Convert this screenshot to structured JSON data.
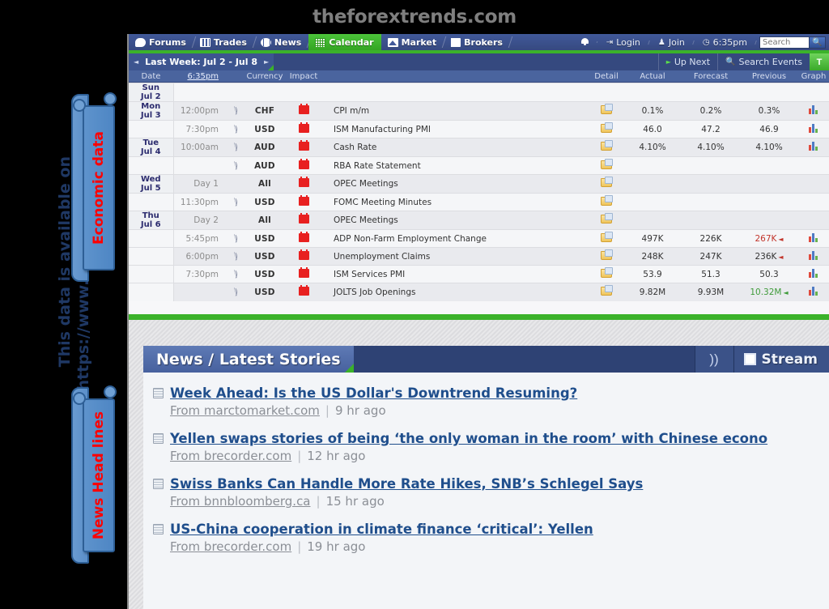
{
  "site_title": "theforextrends.com",
  "annotation": {
    "vertical_note_line1": "This data is available on",
    "vertical_note_line2": "https://www.forexfactory.com",
    "ribbon_economic": "Economic data",
    "ribbon_news": "News Head lines"
  },
  "nav": {
    "items": [
      {
        "label": "Forums",
        "icon": "forums-icon",
        "active": false
      },
      {
        "label": "Trades",
        "icon": "trades-icon",
        "active": false
      },
      {
        "label": "News",
        "icon": "news-icon",
        "active": false
      },
      {
        "label": "Calendar",
        "icon": "calendar-icon",
        "active": true
      },
      {
        "label": "Market",
        "icon": "market-icon",
        "active": false
      },
      {
        "label": "Brokers",
        "icon": "brokers-icon",
        "active": false
      }
    ],
    "right": {
      "bell": "notification-bell-icon",
      "login": "Login",
      "join": "Join",
      "clock": "6:35pm",
      "search_placeholder": "Search",
      "search_value": ""
    }
  },
  "subbar": {
    "prev_arrow": "◄",
    "week_label": "Last Week: Jul 2 - Jul 8",
    "next_arrow": "►",
    "up_next": "Up Next",
    "search_events": "Search Events",
    "filter": "T"
  },
  "columns": {
    "date": "Date",
    "time": "6:35pm",
    "currency": "Currency",
    "impact": "Impact",
    "detail": "Detail",
    "actual": "Actual",
    "forecast": "Forecast",
    "previous": "Previous",
    "graph": "Graph"
  },
  "calendar_rows": [
    {
      "date": "Sun\nJul 2",
      "date_main": "Sun",
      "date_sub": "Jul 2",
      "time": "",
      "sound": false,
      "currency": "",
      "impact": false,
      "event": "",
      "detail": false,
      "actual": "",
      "actual_color": "dark",
      "forecast": "",
      "previous": "",
      "previous_color": "dark",
      "previous_arrow": "",
      "graph": false
    },
    {
      "date_main": "Mon",
      "date_sub": "Jul 3",
      "time": "12:00pm",
      "sound": true,
      "currency": "CHF",
      "impact": true,
      "event": "CPI m/m",
      "detail": true,
      "actual": "0.1%",
      "actual_color": "red",
      "forecast": "0.2%",
      "previous": "0.3%",
      "previous_color": "dark",
      "previous_arrow": "",
      "graph": true
    },
    {
      "date_main": "",
      "date_sub": "",
      "time": "7:30pm",
      "sound": true,
      "currency": "USD",
      "impact": true,
      "event": "ISM Manufacturing PMI",
      "detail": true,
      "actual": "46.0",
      "actual_color": "red",
      "forecast": "47.2",
      "previous": "46.9",
      "previous_color": "dark",
      "previous_arrow": "",
      "graph": true
    },
    {
      "date_main": "Tue",
      "date_sub": "Jul 4",
      "time": "10:00am",
      "sound": true,
      "currency": "AUD",
      "impact": true,
      "event": "Cash Rate",
      "detail": true,
      "actual": "4.10%",
      "actual_color": "dark",
      "forecast": "4.10%",
      "previous": "4.10%",
      "previous_color": "dark",
      "previous_arrow": "",
      "graph": true
    },
    {
      "date_main": "",
      "date_sub": "",
      "time": "",
      "sound": true,
      "currency": "AUD",
      "impact": true,
      "event": "RBA Rate Statement",
      "detail": true,
      "actual": "",
      "actual_color": "dark",
      "forecast": "",
      "previous": "",
      "previous_color": "dark",
      "previous_arrow": "",
      "graph": false
    },
    {
      "date_main": "Wed",
      "date_sub": "Jul 5",
      "time": "Day 1",
      "sound": false,
      "currency": "All",
      "impact": true,
      "event": "OPEC Meetings",
      "detail": true,
      "actual": "",
      "actual_color": "dark",
      "forecast": "",
      "previous": "",
      "previous_color": "dark",
      "previous_arrow": "",
      "graph": false
    },
    {
      "date_main": "",
      "date_sub": "",
      "time": "11:30pm",
      "sound": true,
      "currency": "USD",
      "impact": true,
      "event": "FOMC Meeting Minutes",
      "detail": true,
      "actual": "",
      "actual_color": "dark",
      "forecast": "",
      "previous": "",
      "previous_color": "dark",
      "previous_arrow": "",
      "graph": false
    },
    {
      "date_main": "Thu",
      "date_sub": "Jul 6",
      "time": "Day 2",
      "sound": false,
      "currency": "All",
      "impact": true,
      "event": "OPEC Meetings",
      "detail": true,
      "actual": "",
      "actual_color": "dark",
      "forecast": "",
      "previous": "",
      "previous_color": "dark",
      "previous_arrow": "",
      "graph": false
    },
    {
      "date_main": "",
      "date_sub": "",
      "time": "5:45pm",
      "sound": true,
      "currency": "USD",
      "impact": true,
      "event": "ADP Non-Farm Employment Change",
      "detail": true,
      "actual": "497K",
      "actual_color": "green",
      "forecast": "226K",
      "previous": "267K",
      "previous_color": "red",
      "previous_arrow": "◄",
      "graph": true
    },
    {
      "date_main": "",
      "date_sub": "",
      "time": "6:00pm",
      "sound": true,
      "currency": "USD",
      "impact": true,
      "event": "Unemployment Claims",
      "detail": true,
      "actual": "248K",
      "actual_color": "dark",
      "forecast": "247K",
      "previous": "236K",
      "previous_color": "dark",
      "previous_arrow": "◄",
      "graph": true
    },
    {
      "date_main": "",
      "date_sub": "",
      "time": "7:30pm",
      "sound": true,
      "currency": "USD",
      "impact": true,
      "event": "ISM Services PMI",
      "detail": true,
      "actual": "53.9",
      "actual_color": "green",
      "forecast": "51.3",
      "previous": "50.3",
      "previous_color": "dark",
      "previous_arrow": "",
      "graph": true
    },
    {
      "date_main": "",
      "date_sub": "",
      "time": "",
      "sound": true,
      "currency": "USD",
      "impact": true,
      "event": "JOLTS Job Openings",
      "detail": true,
      "actual": "9.82M",
      "actual_color": "red",
      "forecast": "9.93M",
      "previous": "10.32M",
      "previous_color": "green",
      "previous_arrow": "◄",
      "graph": true
    }
  ],
  "news": {
    "title": "News / Latest Stories",
    "sound_icon": "sound-icon",
    "stream_label": "Stream",
    "stories": [
      {
        "title": "Week Ahead: Is the US Dollar's Downtrend Resuming?",
        "source": "From marctomarket.com",
        "separator": "|",
        "age": "9 hr ago"
      },
      {
        "title": "Yellen swaps stories of being ‘the only woman in the room’ with Chinese econo",
        "source": "From brecorder.com",
        "separator": "|",
        "age": "12 hr ago"
      },
      {
        "title": "Swiss Banks Can Handle More Rate Hikes, SNB’s Schlegel Says",
        "source": "From bnnbloomberg.ca",
        "separator": "|",
        "age": "15 hr ago"
      },
      {
        "title": "US-China cooperation in climate finance ‘critical’: Yellen",
        "source": "From brecorder.com",
        "separator": "|",
        "age": "19 hr ago"
      }
    ]
  },
  "colors": {
    "brand_blue": "#3d5590",
    "accent_green": "#3bb22a",
    "value_red": "#c2352b",
    "value_green": "#3f9b3a",
    "annotation_red": "#ff0000",
    "annotation_blue": "#1f3864"
  }
}
